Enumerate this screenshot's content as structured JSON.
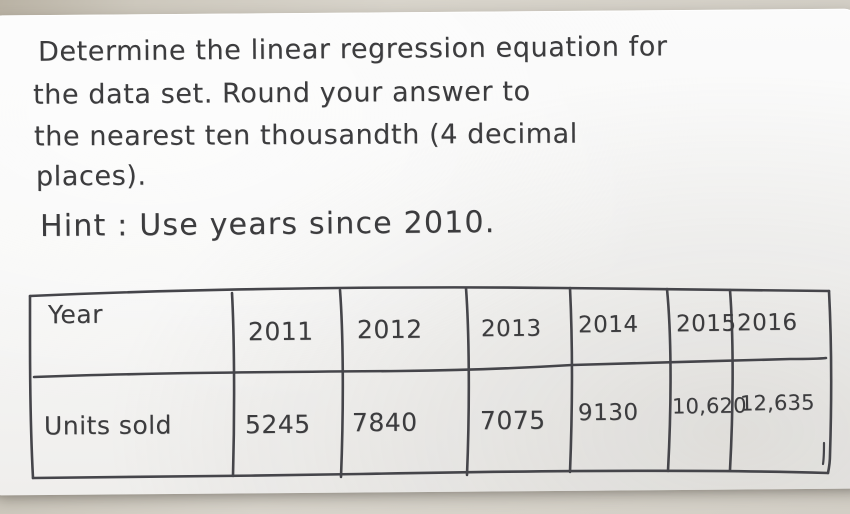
{
  "medium": "handwritten note on white paper",
  "ink_color": "#3c3c3e",
  "paper_color": "#f9f9f8",
  "background_color": "#cdc8bd",
  "problem": {
    "lines": [
      "Determine the linear regression equation for",
      "the data set. Round your answer to",
      "the nearest ten thousandth (4 decimal",
      "places)."
    ],
    "hint": "Hint : Use years since 2010."
  },
  "chart_data": {
    "type": "table",
    "title": "",
    "row_labels": [
      "Year",
      "Units sold"
    ],
    "categories": [
      "2011",
      "2012",
      "2013",
      "2014",
      "2015",
      "2016"
    ],
    "values": [
      5245,
      7840,
      7075,
      9130,
      10620,
      12635
    ],
    "value_labels": [
      "5245",
      "7840",
      "7075",
      "9130",
      "10,620",
      "12,635"
    ],
    "rows": [
      {
        "label": "Year",
        "cells": [
          "2011",
          "2012",
          "2013",
          "2014",
          "2015",
          "2016"
        ]
      },
      {
        "label": "Units sold",
        "cells": [
          "5245",
          "7840",
          "7075",
          "9130",
          "10,620",
          "12,635"
        ]
      }
    ],
    "xlabel": "Year",
    "ylabel": "Units sold",
    "grid": true,
    "legend": "none"
  }
}
